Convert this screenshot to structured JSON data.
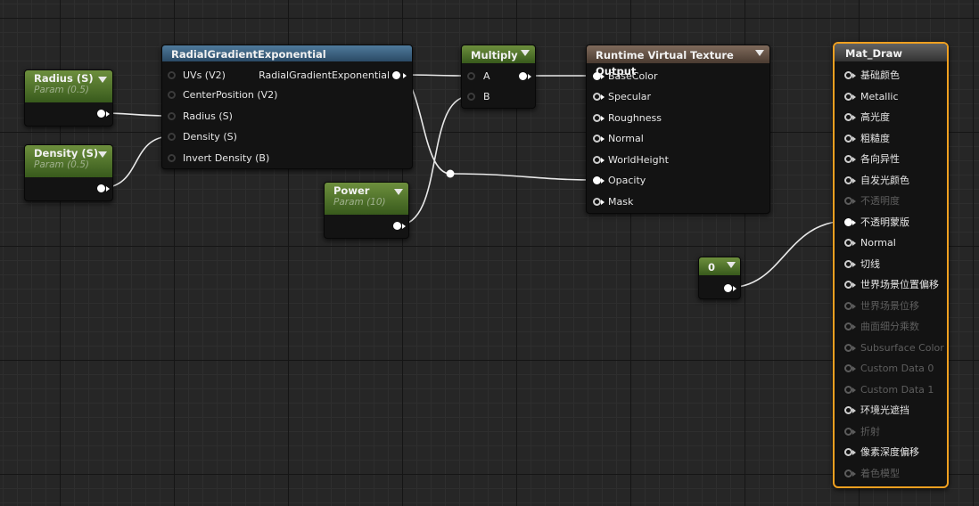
{
  "nodes": {
    "radius": {
      "title": "Radius (S)",
      "subtitle": "Param (0.5)"
    },
    "density": {
      "title": "Density (S)",
      "subtitle": "Param (0.5)"
    },
    "radial": {
      "title": "RadialGradientExponential",
      "output": "RadialGradientExponential",
      "inputs": [
        "UVs (V2)",
        "CenterPosition (V2)",
        "Radius (S)",
        "Density (S)",
        "Invert Density (B)"
      ]
    },
    "power": {
      "title": "Power",
      "subtitle": "Param (10)"
    },
    "multiply": {
      "title": "Multiply",
      "inputs": [
        "A",
        "B"
      ]
    },
    "rvt": {
      "title": "Runtime Virtual Texture Output",
      "inputs": [
        "BaseColor",
        "Specular",
        "Roughness",
        "Normal",
        "WorldHeight",
        "Opacity",
        "Mask"
      ]
    },
    "const0": {
      "title": "0"
    },
    "mat": {
      "title": "Mat_Draw",
      "inputs": [
        {
          "label": "基础颜色",
          "state": "off"
        },
        {
          "label": "Metallic",
          "state": "off"
        },
        {
          "label": "高光度",
          "state": "off"
        },
        {
          "label": "粗糙度",
          "state": "off"
        },
        {
          "label": "各向异性",
          "state": "off"
        },
        {
          "label": "自发光颜色",
          "state": "off"
        },
        {
          "label": "不透明度",
          "state": "dim"
        },
        {
          "label": "不透明蒙版",
          "state": "on"
        },
        {
          "label": "Normal",
          "state": "off"
        },
        {
          "label": "切线",
          "state": "off"
        },
        {
          "label": "世界场景位置偏移",
          "state": "off"
        },
        {
          "label": "世界场景位移",
          "state": "dim"
        },
        {
          "label": "曲面细分乘数",
          "state": "dim"
        },
        {
          "label": "Subsurface Color",
          "state": "dim"
        },
        {
          "label": "Custom Data 0",
          "state": "dim"
        },
        {
          "label": "Custom Data 1",
          "state": "dim"
        },
        {
          "label": "环境光遮挡",
          "state": "off"
        },
        {
          "label": "折射",
          "state": "dim"
        },
        {
          "label": "像素深度偏移",
          "state": "off"
        },
        {
          "label": "着色模型",
          "state": "dim"
        }
      ]
    }
  },
  "colors": {
    "wire": "#e8e8e8",
    "selection": "#f0a020",
    "param_header": "#4d7328",
    "function_header": "#3a6182",
    "rvt_header": "#6a5546"
  }
}
